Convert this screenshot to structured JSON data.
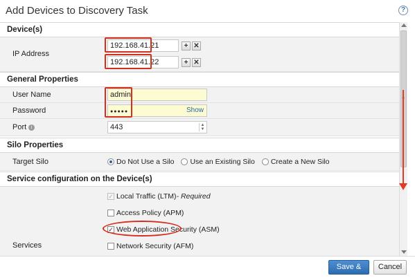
{
  "dialog": {
    "title": "Add Devices to Discovery Task",
    "help_icon_glyph": "?"
  },
  "devices": {
    "header": "Device(s)",
    "ip_label": "IP Address",
    "ip_addresses": [
      "192.168.41.21",
      "192.168.41.22"
    ],
    "add_glyph": "+",
    "remove_glyph": "✕"
  },
  "general": {
    "header": "General Properties",
    "username_label": "User Name",
    "username_value": "admin",
    "password_label": "Password",
    "password_value": "●●●●●",
    "show_label": "Show",
    "port_label": "Port",
    "port_help_glyph": "i",
    "port_value": "443"
  },
  "silo": {
    "header": "Silo Properties",
    "target_label": "Target Silo",
    "options": [
      "Do Not Use a Silo",
      "Use an Existing Silo",
      "Create a New Silo"
    ],
    "selected": "Do Not Use a Silo"
  },
  "service": {
    "header": "Service configuration on the Device(s)",
    "services_label": "Services",
    "items": [
      {
        "label": "Local Traffic (LTM)",
        "suffix": " - Required",
        "checked": true,
        "disabled": true
      },
      {
        "label": "Access Policy (APM)",
        "checked": false
      },
      {
        "label": "Web Application Security (ASM)",
        "checked": true
      },
      {
        "label": "Network Security (AFM)",
        "checked": false
      }
    ]
  },
  "footer": {
    "save_label": "Save & Close",
    "cancel_label": "Cancel"
  },
  "colors": {
    "highlight": "#d32f1e",
    "primary_button": "#2d6bb0",
    "input_autofill": "#fdfbd2",
    "link": "#2967a6"
  }
}
